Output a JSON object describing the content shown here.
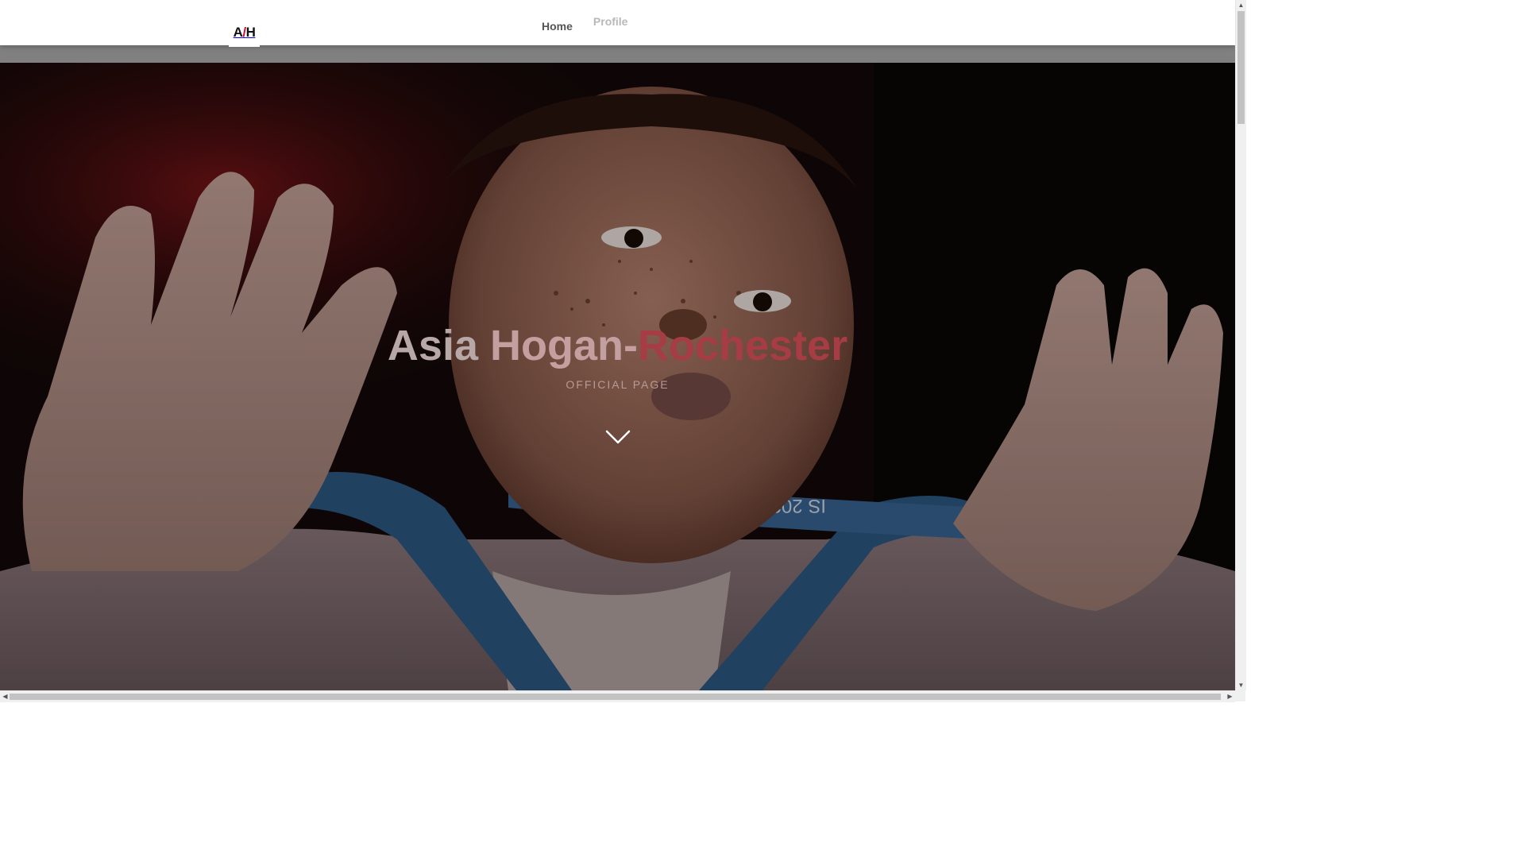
{
  "brand": {
    "logo_left": "A",
    "logo_slash": "/",
    "logo_right": "H",
    "accent_color": "#c8102e"
  },
  "nav": {
    "items": [
      {
        "label": "Home"
      },
      {
        "label": "Profile"
      }
    ]
  },
  "hero": {
    "title_part1": "Asia",
    "title_part2": "Hogan-",
    "title_part3": "Rochester",
    "subtitle": "OFFICIAL PAGE",
    "scroll_icon": "chevron-down-icon",
    "photo_text": "IS 2024"
  },
  "scrollbars": {
    "up_icon": "▲",
    "down_icon": "▼",
    "left_icon": "◀",
    "right_icon": "▶"
  }
}
